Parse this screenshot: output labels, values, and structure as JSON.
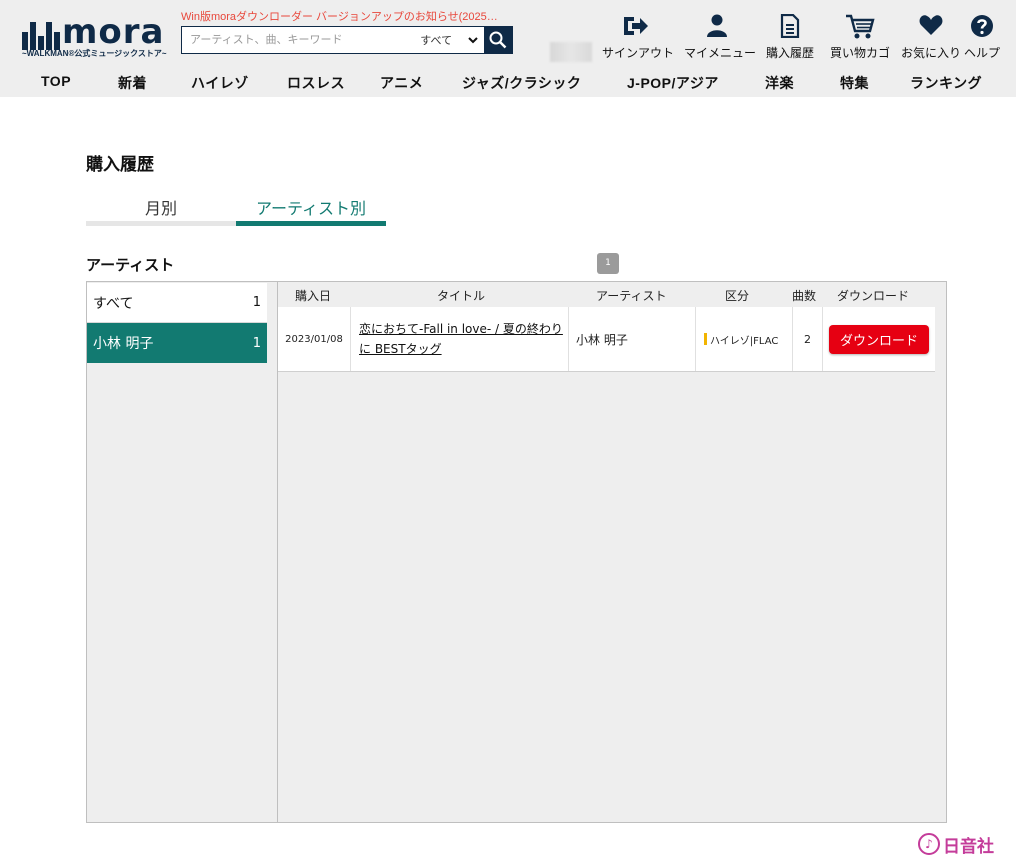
{
  "header": {
    "logo": {
      "word": "mora",
      "subtitle": "~WALKMAN®公式ミュージックストア~"
    },
    "news": "Win版moraダウンローダー バージョンアップのお知らせ(2025…",
    "search": {
      "placeholder": "アーティスト、曲、キーワード",
      "scope": "すべて"
    },
    "top_links": [
      {
        "label": "サインアウト",
        "icon": "sign-out-icon"
      },
      {
        "label": "マイメニュー",
        "icon": "user-icon"
      },
      {
        "label": "購入履歴",
        "icon": "document-icon"
      },
      {
        "label": "買い物カゴ",
        "icon": "cart-icon"
      },
      {
        "label": "お気に入り",
        "icon": "heart-icon"
      },
      {
        "label": "ヘルプ",
        "icon": "help-icon"
      }
    ],
    "categories": [
      "TOP",
      "新着",
      "ハイレゾ",
      "ロスレス",
      "アニメ",
      "ジャズ/クラシック",
      "J-POP/アジア",
      "洋楽",
      "特集",
      "ランキング"
    ]
  },
  "main": {
    "title": "購入履歴",
    "tabs": [
      {
        "label": "月別",
        "active": false
      },
      {
        "label": "アーティスト別",
        "active": true
      }
    ],
    "artist_heading": "アーティスト",
    "page_number": "1",
    "artists": [
      {
        "name": "すべて",
        "count": "1",
        "selected": false
      },
      {
        "name": "小林 明子",
        "count": "1",
        "selected": true
      }
    ],
    "columns": [
      "購入日",
      "タイトル",
      "アーティスト",
      "区分",
      "曲数",
      "ダウンロード"
    ],
    "rows": [
      {
        "date": "2023/01/08",
        "title": "恋におちて-Fall in love- / 夏の終わりに BESTタッグ",
        "artist": "小林 明子",
        "kind": "ハイレゾ|FLAC",
        "tracks": "2",
        "download_label": "ダウンロード"
      }
    ]
  },
  "watermark_badge": {
    "text": "日音社"
  },
  "colors": {
    "brand_navy": "#0f2a47",
    "accent_teal": "#127a71",
    "download_red": "#e60012",
    "news_red": "#e8473b",
    "hires_yellow": "#f2b400"
  }
}
